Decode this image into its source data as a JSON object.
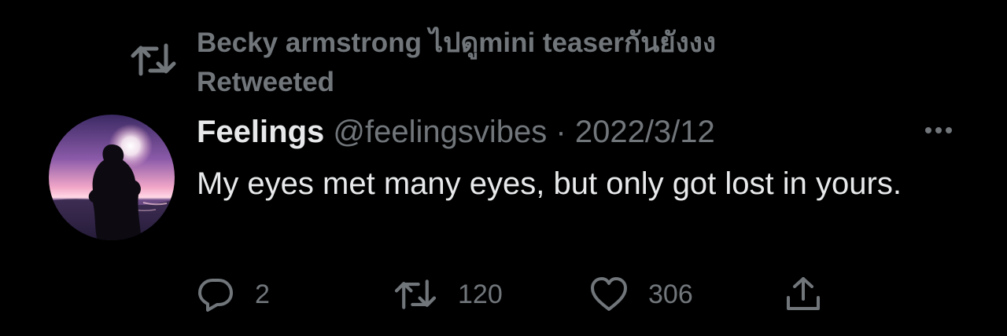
{
  "social_context": {
    "text": "Becky armstrong ไปดูmini teaserกันยังงง Retweeted",
    "icon": "retweet-icon"
  },
  "tweet": {
    "author_name": "Feelings",
    "handle": "@feelingsvibes",
    "separator": "·",
    "date": "2022/3/12",
    "text": "My eyes met many eyes, but only got lost in yours.",
    "avatar_icon": "sunset-silhouette-avatar"
  },
  "actions": {
    "reply_count": "2",
    "retweet_count": "120",
    "like_count": "306",
    "icons": [
      "reply-icon",
      "retweet-icon",
      "heart-icon",
      "share-icon"
    ]
  },
  "colors": {
    "background": "#000000",
    "primary_text": "#e7e9ea",
    "secondary_text": "#71767b"
  }
}
